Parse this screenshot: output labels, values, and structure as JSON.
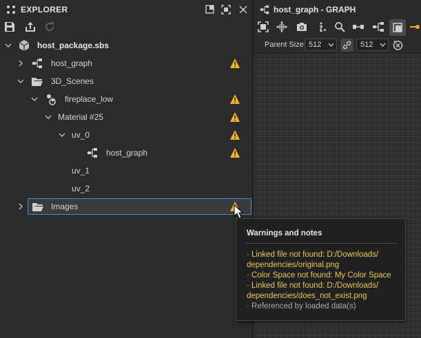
{
  "explorer": {
    "title": "EXPLORER",
    "header_icons": [
      "maximize-panel-icon",
      "float-panel-icon",
      "close-icon"
    ],
    "toolbar_icons": [
      "save-icon",
      "publish-icon",
      "reload-icon"
    ],
    "tree": [
      {
        "label": "host_package.sbs",
        "icon": "package-icon",
        "expanded": true,
        "warning": false,
        "bold": true
      },
      {
        "label": "host_graph",
        "icon": "graph-icon",
        "expanded": false,
        "warning": true
      },
      {
        "label": "3D_Scenes",
        "icon": "folder-open-icon",
        "expanded": true,
        "warning": false
      },
      {
        "label": "fireplace_low",
        "icon": "scene-icon",
        "expanded": true,
        "warning": true
      },
      {
        "label": "Material #25",
        "icon": "",
        "expanded": true,
        "warning": true
      },
      {
        "label": "uv_0",
        "icon": "",
        "expanded": true,
        "warning": true
      },
      {
        "label": "host_graph",
        "icon": "graph-icon",
        "expanded": false,
        "warning": true
      },
      {
        "label": "uv_1",
        "icon": "",
        "warning": false
      },
      {
        "label": "uv_2",
        "icon": "",
        "warning": false
      },
      {
        "label": "Images",
        "icon": "folder-open-icon",
        "expanded": false,
        "warning": true,
        "selected": true
      }
    ]
  },
  "graph": {
    "title": "host_graph - GRAPH",
    "toolbar_icons": [
      "frame-all-icon",
      "frame-selected-icon",
      "camera-icon",
      "info-icon",
      "search-icon",
      "connect-icon",
      "graph-layout-icon",
      "pin-icon"
    ],
    "parent_size_label": "Parent Size:",
    "parent_size_width": "512",
    "parent_size_height": "512"
  },
  "tooltip": {
    "title": "Warnings and notes",
    "lines": [
      {
        "text": "· Linked file not found: D:/Downloads/",
        "kind": "warning"
      },
      {
        "text": "dependencies/original.png",
        "kind": "warning"
      },
      {
        "text": "· Color Space not found: My Color Space",
        "kind": "warning"
      },
      {
        "text": "· Linked file not found: D:/Downloads/",
        "kind": "warning"
      },
      {
        "text": "dependencies/does_not_exist.png",
        "kind": "warning"
      },
      {
        "text": "· Referenced by loaded data(s)",
        "kind": "info"
      }
    ]
  },
  "colors": {
    "warning": "#f0b429",
    "selection_border": "#3f8fdc",
    "tooltip_text": "#e8c84a",
    "accent_orange": "#f5a623"
  }
}
